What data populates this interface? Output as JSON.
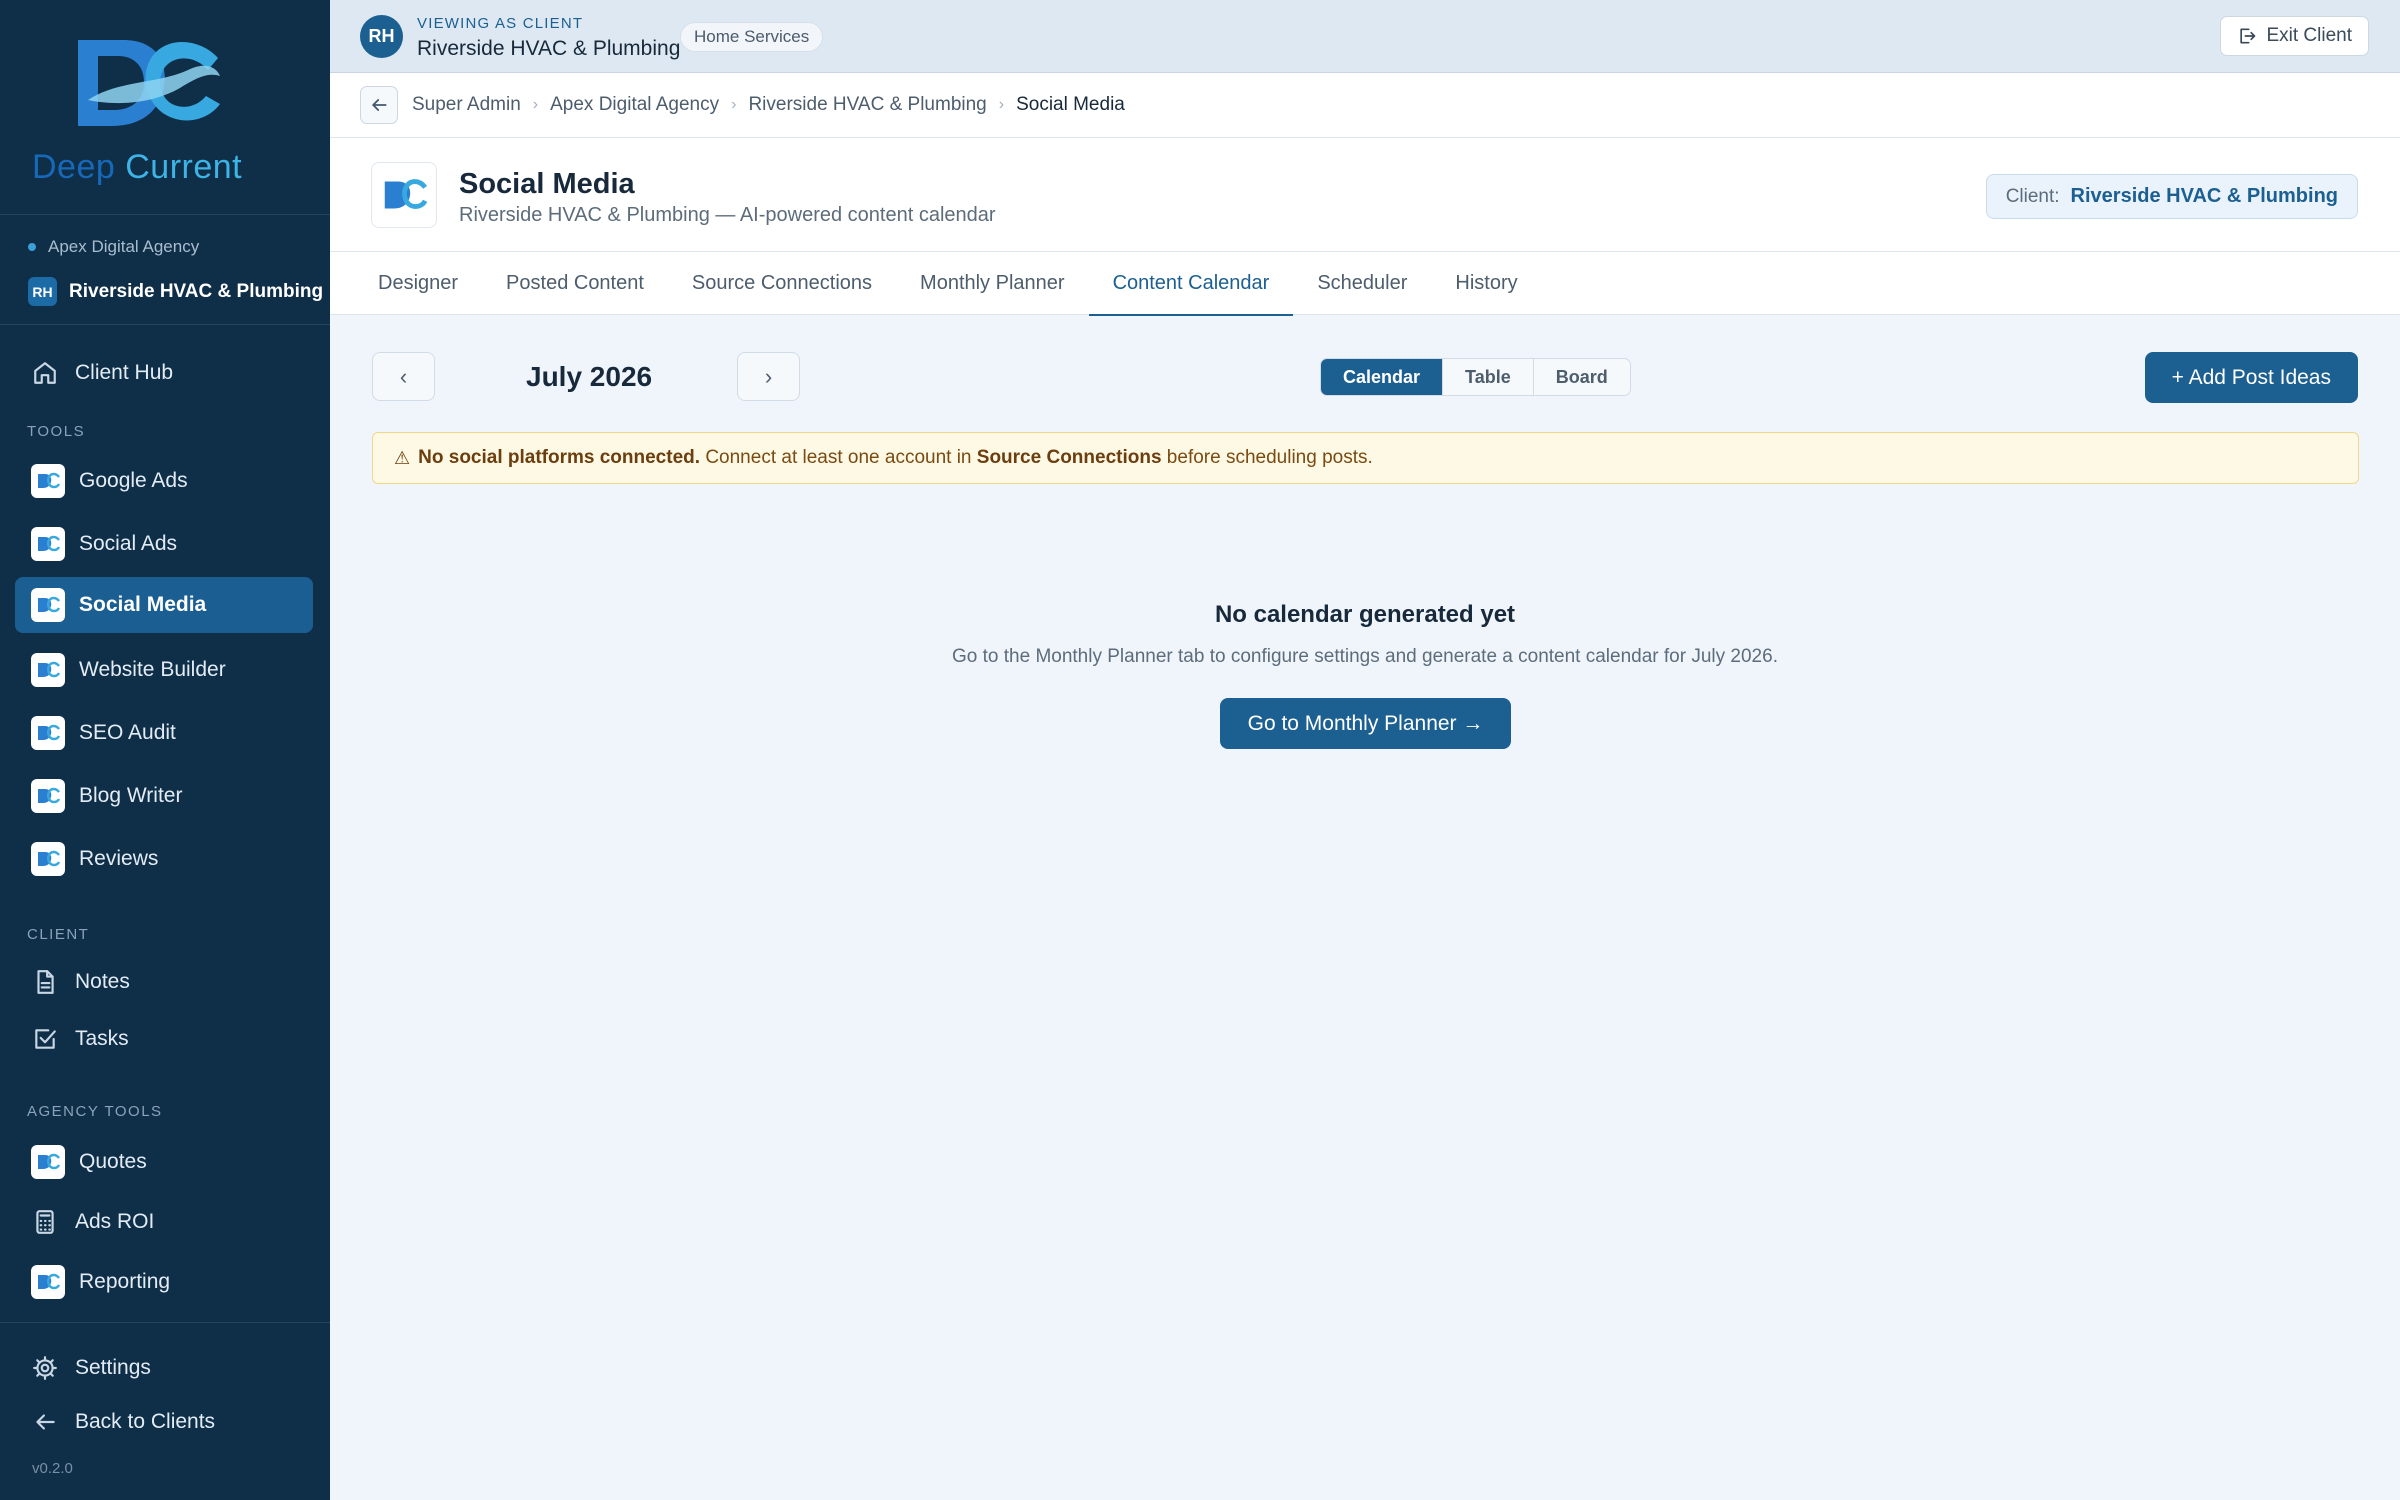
{
  "brand": {
    "word1": "Deep",
    "word2": "Current",
    "version": "v0.2.0"
  },
  "sidebar": {
    "agency": "Apex Digital Agency",
    "client_initials": "RH",
    "client_name": "Riverside HVAC & Plumbing",
    "top_item": {
      "label": "Client Hub",
      "icon": "home-icon"
    },
    "sections": {
      "tools": "TOOLS",
      "client": "CLIENT",
      "agency_tools": "AGENCY TOOLS"
    },
    "tools": [
      {
        "label": "Google Ads"
      },
      {
        "label": "Social Ads"
      },
      {
        "label": "Social Media",
        "active": true
      },
      {
        "label": "Website Builder"
      },
      {
        "label": "SEO Audit"
      },
      {
        "label": "Blog Writer"
      },
      {
        "label": "Reviews"
      }
    ],
    "client_items": [
      {
        "label": "Notes",
        "icon": "document-icon"
      },
      {
        "label": "Tasks",
        "icon": "checkbox-icon"
      }
    ],
    "agency_items": [
      {
        "label": "Quotes"
      },
      {
        "label": "Ads ROI",
        "icon": "calculator-icon"
      },
      {
        "label": "Reporting"
      }
    ],
    "settings": "Settings",
    "back": "Back to Clients"
  },
  "topbar": {
    "initials": "RH",
    "viewing_label": "VIEWING AS CLIENT",
    "client_name": "Riverside HVAC & Plumbing",
    "tag": "Home Services",
    "exit": "Exit Client"
  },
  "breadcrumb": [
    "Super Admin",
    "Apex Digital Agency",
    "Riverside HVAC & Plumbing",
    "Social Media"
  ],
  "header": {
    "title": "Social Media",
    "subtitle": "Riverside HVAC & Plumbing — AI-powered content calendar",
    "client_label": "Client:",
    "client_value": "Riverside HVAC & Plumbing"
  },
  "tabs": [
    "Designer",
    "Posted Content",
    "Source Connections",
    "Monthly Planner",
    "Content Calendar",
    "Scheduler",
    "History"
  ],
  "active_tab": "Content Calendar",
  "calendar": {
    "prev": "‹",
    "next": "›",
    "month": "July 2026",
    "views": [
      "Calendar",
      "Table",
      "Board"
    ],
    "active_view": "Calendar",
    "add_button": "+ Add Post Ideas"
  },
  "alert": {
    "icon": "⚠",
    "bold": "No social platforms connected.",
    "text1": " Connect at least one account in ",
    "link": "Source Connections",
    "text2": " before scheduling posts."
  },
  "empty": {
    "title": "No calendar generated yet",
    "subtitle": "Go to the Monthly Planner tab to configure settings and generate a content calendar for July 2026.",
    "button": "Go to Monthly Planner →"
  },
  "colors": {
    "sidebar": "#0f2e48",
    "accent": "#1c5f91",
    "warning_bg": "#fdf9e4"
  }
}
